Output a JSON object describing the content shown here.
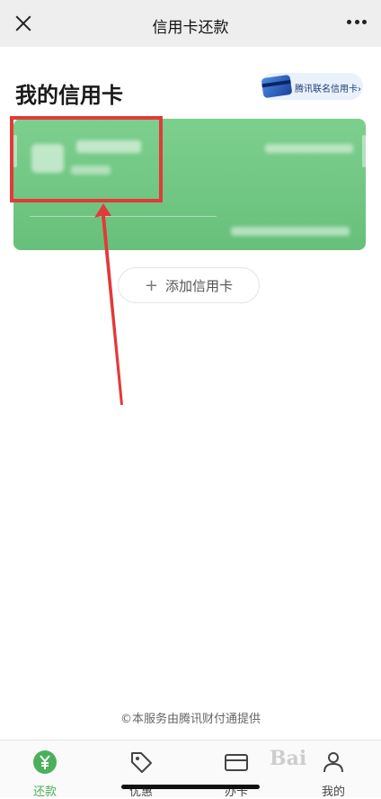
{
  "header": {
    "title": "信用卡还款"
  },
  "heading": {
    "text": "我的信用卡"
  },
  "promo": {
    "text": "腾讯联名信用卡",
    "chevron": "›"
  },
  "add_card": {
    "label": "添加信用卡",
    "plus": "+"
  },
  "footer": {
    "text": "©本服务由腾讯财付通提供"
  },
  "tabs": [
    {
      "label": "还款",
      "icon": "yuan-icon",
      "active": true
    },
    {
      "label": "优惠",
      "icon": "tag-icon",
      "active": false
    },
    {
      "label": "办卡",
      "icon": "card-icon",
      "active": false
    },
    {
      "label": "我的",
      "icon": "user-icon",
      "active": false
    }
  ],
  "watermark": {
    "text": "Bai"
  },
  "colors": {
    "card_green": "#6fc57f",
    "accent_green": "#4caf5c",
    "annotation_red": "#e23a3a"
  }
}
